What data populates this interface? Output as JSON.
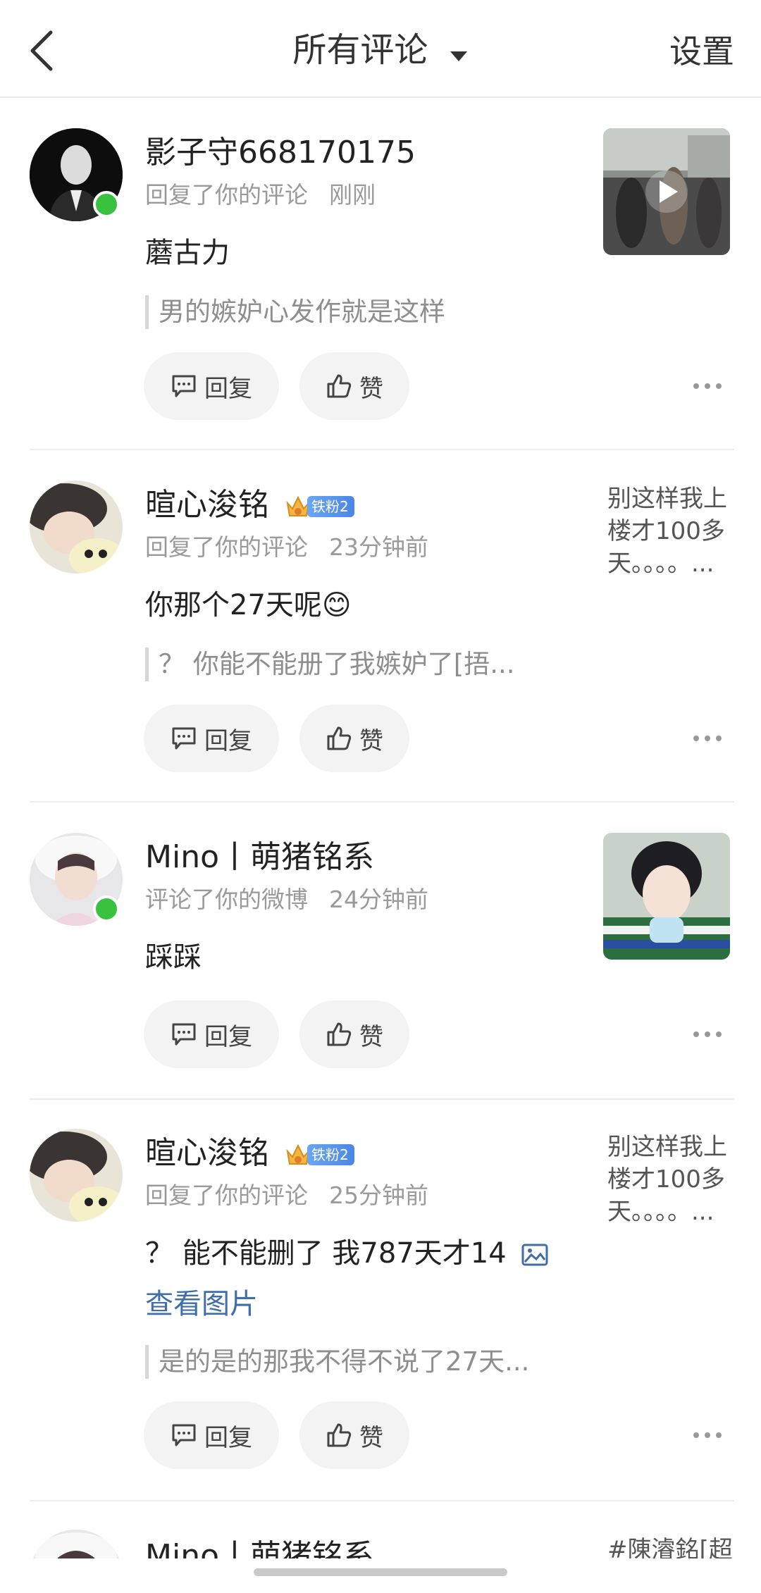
{
  "header": {
    "title": "所有评论",
    "settings": "设置"
  },
  "actions": {
    "reply": "回复",
    "like": "赞"
  },
  "items": [
    {
      "username": "影子守668170175",
      "action": "回复了你的评论",
      "time": "刚刚",
      "content": "蘑古力",
      "quote": "男的嫉妒心发作就是这样",
      "online": true
    },
    {
      "username": "暄心浚铭",
      "badge": "铁粉2",
      "action": "回复了你的评论",
      "time": "23分钟前",
      "content": "你那个27天呢😊",
      "quote": "？ 你能不能册了我嫉妒了[捂...",
      "side_text": "别这样我上楼才100多天。。。。..."
    },
    {
      "username": "Mino丨萌猪铭系",
      "action": "评论了你的微博",
      "time": "24分钟前",
      "content": "踩踩",
      "online": true
    },
    {
      "username": "暄心浚铭",
      "badge": "铁粉2",
      "action": "回复了你的评论",
      "time": "25分钟前",
      "content": "？ 能不能删了 我787天才14",
      "view_image": "查看图片",
      "quote": "是的是的那我不得不说了27天...",
      "side_text": "别这样我上楼才100多天。。。。..."
    },
    {
      "username": "Mino丨萌猪铭系",
      "side_text": "#陳濬銘[超"
    }
  ],
  "colors": {
    "online": "#39c23f",
    "link": "#3f6ea8",
    "badge": "#4b86e6"
  }
}
